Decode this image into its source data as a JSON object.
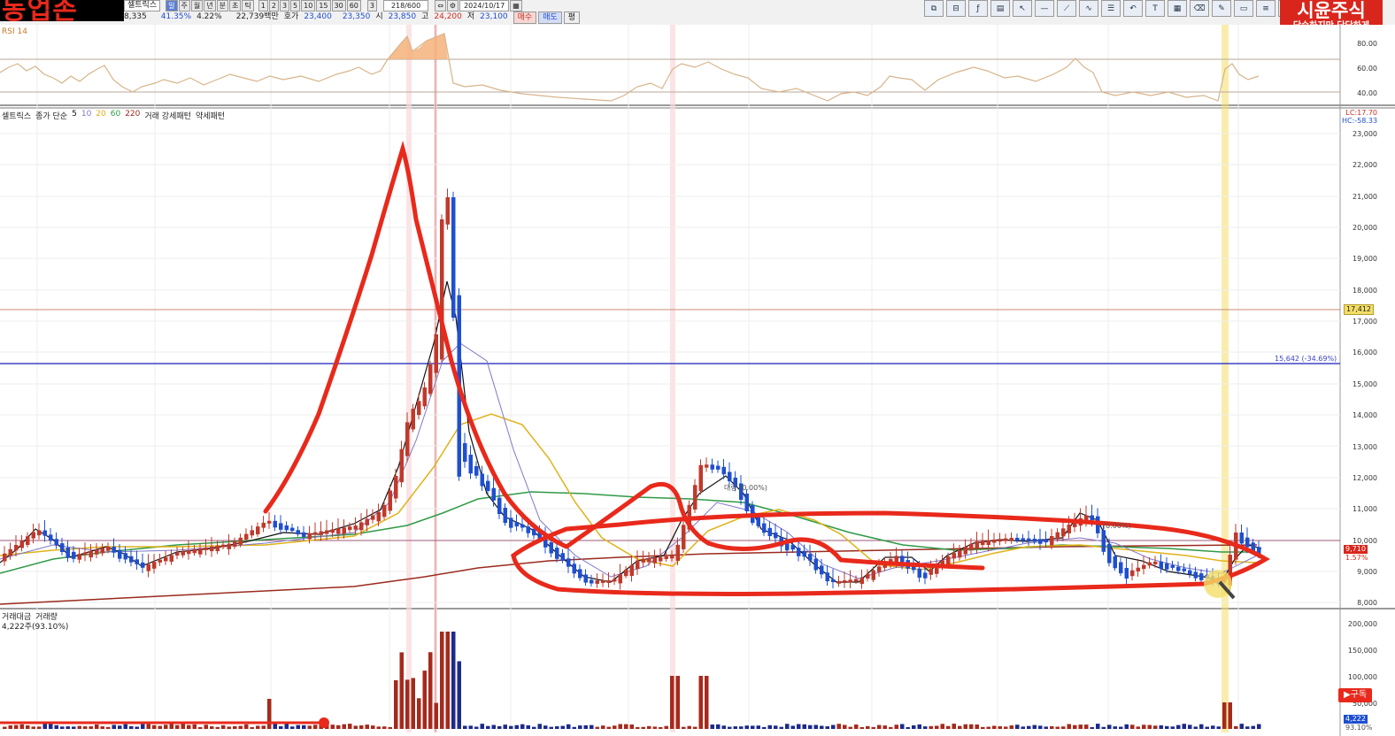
{
  "window": {
    "brand_logo_text": "동업존",
    "brand_badge_title": "시윤주식",
    "brand_badge_subtitle": "단순하지만 단단하게",
    "subscribe_label": "▶구독"
  },
  "quote_bar": {
    "stock_name": "셀트릭스",
    "row1": [
      "8,335",
      "41.35%",
      "4.22%",
      "22,739백만",
      "호가",
      "23,400",
      "23,350",
      "시",
      "23,850",
      "고",
      "24,200",
      "저",
      "23,100"
    ],
    "buy_label": "매수",
    "sell_label": "매도",
    "eval_label": "평",
    "period_buttons": [
      "일",
      "주",
      "월",
      "년",
      "분",
      "초",
      "틱"
    ],
    "interval_buttons": [
      "1",
      "2",
      "3",
      "5",
      "10",
      "15",
      "30",
      "60",
      "3"
    ],
    "count": "218/600",
    "date": "2024/10/17"
  },
  "toolbar": {
    "tools": [
      "layout-icon",
      "split-icon",
      "fx-icon",
      "chart-icon",
      "cursor-icon",
      "hline-icon",
      "trendline-icon",
      "wave-icon",
      "fib-icon",
      "undo-icon",
      "text-icon",
      "grid-icon",
      "eraser-icon",
      "pen-icon",
      "textbox-icon",
      "list-icon",
      "candle-icon"
    ]
  },
  "rsi_panel": {
    "label": "RSI 14",
    "axis_ticks": [
      "80.00",
      "60.00",
      "40.00"
    ]
  },
  "price_panel": {
    "legend": [
      "셀트릭스",
      "종가 단순",
      "5",
      "10",
      "20",
      "60",
      "220",
      "거래 강세패턴",
      "약세패턴"
    ],
    "lc_label": "LC:17.70",
    "hc_label": "HC:-58.33",
    "axis_ticks": [
      "23,000",
      "22,000",
      "21,000",
      "20,000",
      "19,000",
      "18,000",
      "17,000",
      "16,000",
      "15,000",
      "14,000",
      "13,000",
      "12,000",
      "11,000",
      "10,000",
      "9,000",
      "8,000"
    ],
    "tag_upper": "17,412",
    "hline_label": "15,642 (-34.69%)",
    "current_price_tag": "9,710",
    "change_tag": "1.57%",
    "marker_label": "대량 (0.00%)",
    "marker_label2": "(0.00%)"
  },
  "volume_panel": {
    "legend": [
      "거래대금",
      "거래량"
    ],
    "sub_legend": "4,222주(93.10%)",
    "axis_ticks": [
      "200,000",
      "150,000",
      "100,000",
      "50,000"
    ],
    "volume_tag": "4,222",
    "volume_pct_tag": "93.10%"
  },
  "colors": {
    "annotation_red": "#e8291b",
    "up_candle": "#c0392b",
    "down_candle": "#1f4fd1",
    "ma5": "#000000",
    "ma10": "#7f77c8",
    "ma20": "#e0b21a",
    "ma60": "#2f9a46",
    "ma220": "#9a2a1e",
    "highlight_yellow": "#f3df68"
  }
}
